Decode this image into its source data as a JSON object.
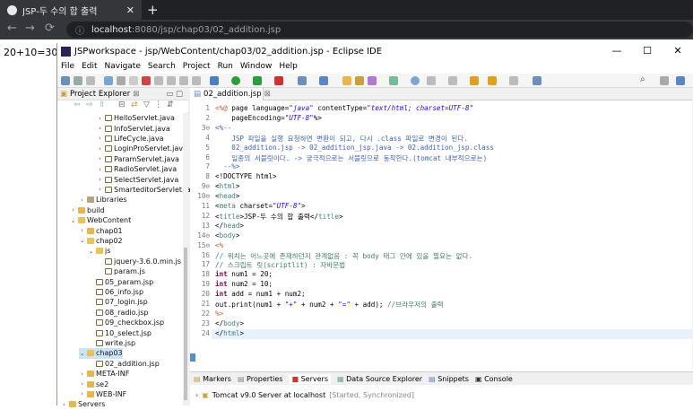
{
  "browser": {
    "tab_title": "JSP-두 수의 합 출력",
    "tab_close": "✕",
    "new_tab": "+",
    "url_host": "localhost",
    "url_path": ":8080/jsp/chap03/02_addition.jsp",
    "back": "←",
    "forward": "→",
    "reload": "⟳"
  },
  "page": {
    "output_text": "20+10=30"
  },
  "eclipse": {
    "window_title": "JSPworkspace - jsp/WebContent/chap03/02_addition.jsp - Eclipse IDE",
    "window_buttons": [
      "—",
      "☐",
      "✕"
    ],
    "menu": [
      "File",
      "Edit",
      "Navigate",
      "Search",
      "Project",
      "Run",
      "Window",
      "Help"
    ],
    "explorer_title": "Project Explorer",
    "explorer_close": "⊠",
    "tree": [
      {
        "label": "HelloServlet.java",
        "indent": 4,
        "kind": "java"
      },
      {
        "label": "InfoServlet.java",
        "indent": 4,
        "kind": "java"
      },
      {
        "label": "LifeCycle.java",
        "indent": 4,
        "kind": "java"
      },
      {
        "label": "LoginProServlet.java",
        "indent": 4,
        "kind": "java"
      },
      {
        "label": "ParamServlet.java",
        "indent": 4,
        "kind": "java"
      },
      {
        "label": "RadioServlet.java",
        "indent": 4,
        "kind": "java"
      },
      {
        "label": "SelectServlet.java",
        "indent": 4,
        "kind": "java"
      },
      {
        "label": "SmarteditorServlet.java",
        "indent": 4,
        "kind": "java"
      },
      {
        "label": "Libraries",
        "indent": 2,
        "kind": "lib"
      },
      {
        "label": "build",
        "indent": 1,
        "kind": "folder"
      },
      {
        "label": "WebContent",
        "indent": 1,
        "kind": "folder-open"
      },
      {
        "label": "chap01",
        "indent": 2,
        "kind": "folder"
      },
      {
        "label": "chap02",
        "indent": 2,
        "kind": "folder-open"
      },
      {
        "label": "js",
        "indent": 3,
        "kind": "folder-open"
      },
      {
        "label": "jquery-3.6.0.min.js",
        "indent": 4,
        "kind": "file"
      },
      {
        "label": "param.js",
        "indent": 4,
        "kind": "file"
      },
      {
        "label": "05_param.jsp",
        "indent": 3,
        "kind": "file"
      },
      {
        "label": "06_info.jsp",
        "indent": 3,
        "kind": "file"
      },
      {
        "label": "07_login.jsp",
        "indent": 3,
        "kind": "file"
      },
      {
        "label": "08_radio.jsp",
        "indent": 3,
        "kind": "file"
      },
      {
        "label": "09_checkbox.jsp",
        "indent": 3,
        "kind": "file"
      },
      {
        "label": "10_select.jsp",
        "indent": 3,
        "kind": "file"
      },
      {
        "label": "write.jsp",
        "indent": 3,
        "kind": "file"
      },
      {
        "label": "chap03",
        "indent": 2,
        "kind": "folder-open",
        "selected": true
      },
      {
        "label": "02_addition.jsp",
        "indent": 3,
        "kind": "file"
      },
      {
        "label": "META-INF",
        "indent": 2,
        "kind": "folder"
      },
      {
        "label": "se2",
        "indent": 2,
        "kind": "folder"
      },
      {
        "label": "WEB-INF",
        "indent": 2,
        "kind": "folder"
      },
      {
        "label": "Servers",
        "indent": 0,
        "kind": "folder"
      }
    ],
    "editor_tab": "02_addition.jsp",
    "editor_tab_close": "⊠",
    "code_lines": [
      {
        "n": "1",
        "t": "<%@ page language=\"java\" contentType=\"text/html; charset=UTF-8\""
      },
      {
        "n": "2",
        "t": "    pageEncoding=\"UTF-8\"%>"
      },
      {
        "n": "3⊖",
        "t": "<%--"
      },
      {
        "n": "4",
        "t": "    JSP 파일을 실행 요청하면 변환이 되고, 다시 .class 파일로 변경이 된다."
      },
      {
        "n": "5",
        "t": "    02_addition.jsp -> 02_addition_jsp.java -> 02.addition_jsp.class"
      },
      {
        "n": "6",
        "t": "    일종의 서블릿이다. -> 궁극적으로는 서블릿으로 동작한다.(tomcat 내부적으로는)"
      },
      {
        "n": "7",
        "t": "  --%>"
      },
      {
        "n": "8",
        "t": "<!DOCTYPE html>"
      },
      {
        "n": "9⊖",
        "t": "<html>"
      },
      {
        "n": "10⊖",
        "t": "<head>"
      },
      {
        "n": "11",
        "t": "<meta charset=\"UTF-8\">"
      },
      {
        "n": "12",
        "t": "<title>JSP-두 수의 합 출력</title>"
      },
      {
        "n": "13",
        "t": "</head>"
      },
      {
        "n": "14⊖",
        "t": "<body>"
      },
      {
        "n": "15⊖",
        "t": "<%"
      },
      {
        "n": "16",
        "t": "// 위치는 어느곳에 존재하던지 관계없음 : 꼭 body 태그 안에 있을 필요는 없다."
      },
      {
        "n": "17",
        "t": "// 스크립트 릿(scriptlit) : 자바문법"
      },
      {
        "n": "18",
        "t": "int num1 = 20;"
      },
      {
        "n": "19",
        "t": "int num2 = 10;"
      },
      {
        "n": "20",
        "t": "int add = num1 + num2;"
      },
      {
        "n": "21",
        "t": "out.print(num1 + \"+\" + num2 + \"=\" + add); //브라우저의 출력"
      },
      {
        "n": "22",
        "t": "%>"
      },
      {
        "n": "23",
        "t": "</body>"
      },
      {
        "n": "24",
        "t": "</html>"
      }
    ],
    "bottom_tabs": [
      "Markers",
      "Properties",
      "Servers",
      "Data Source Explorer",
      "Snippets",
      "Console"
    ],
    "server_name": "Tomcat v9.0 Server at localhost",
    "server_status": "[Started, Synchronized]"
  }
}
